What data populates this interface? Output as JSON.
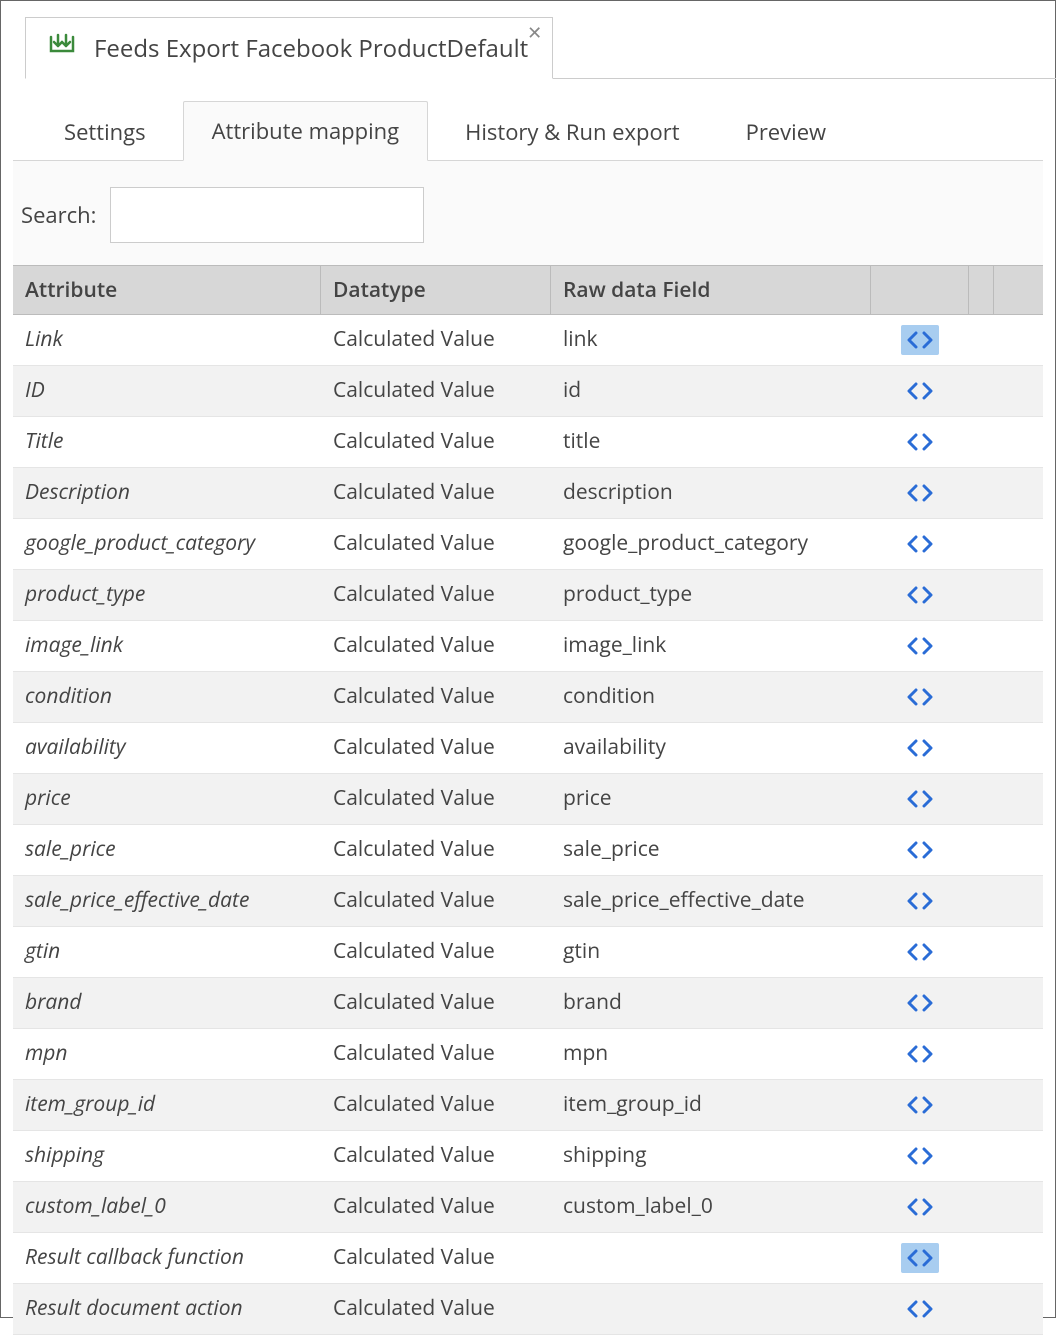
{
  "header": {
    "tab_title": "Feeds Export Facebook ProductDefault"
  },
  "tabs": [
    {
      "label": "Settings",
      "active": false
    },
    {
      "label": "Attribute mapping",
      "active": true
    },
    {
      "label": "History & Run export",
      "active": false
    },
    {
      "label": "Preview",
      "active": false
    }
  ],
  "search": {
    "label": "Search:",
    "value": ""
  },
  "grid": {
    "columns": {
      "attribute": "Attribute",
      "datatype": "Datatype",
      "rawfield": "Raw data Field"
    },
    "rows": [
      {
        "attribute": "Link",
        "datatype": "Calculated Value",
        "rawfield": "link",
        "selected": true
      },
      {
        "attribute": "ID",
        "datatype": "Calculated Value",
        "rawfield": "id",
        "selected": false
      },
      {
        "attribute": "Title",
        "datatype": "Calculated Value",
        "rawfield": "title",
        "selected": false
      },
      {
        "attribute": "Description",
        "datatype": "Calculated Value",
        "rawfield": "description",
        "selected": false
      },
      {
        "attribute": "google_product_category",
        "datatype": "Calculated Value",
        "rawfield": "google_product_category",
        "selected": false
      },
      {
        "attribute": "product_type",
        "datatype": "Calculated Value",
        "rawfield": "product_type",
        "selected": false
      },
      {
        "attribute": "image_link",
        "datatype": "Calculated Value",
        "rawfield": "image_link",
        "selected": false
      },
      {
        "attribute": "condition",
        "datatype": "Calculated Value",
        "rawfield": "condition",
        "selected": false
      },
      {
        "attribute": "availability",
        "datatype": "Calculated Value",
        "rawfield": "availability",
        "selected": false
      },
      {
        "attribute": "price",
        "datatype": "Calculated Value",
        "rawfield": "price",
        "selected": false
      },
      {
        "attribute": "sale_price",
        "datatype": "Calculated Value",
        "rawfield": "sale_price",
        "selected": false
      },
      {
        "attribute": "sale_price_effective_date",
        "datatype": "Calculated Value",
        "rawfield": "sale_price_effective_date",
        "selected": false
      },
      {
        "attribute": "gtin",
        "datatype": "Calculated Value",
        "rawfield": "gtin",
        "selected": false
      },
      {
        "attribute": "brand",
        "datatype": "Calculated Value",
        "rawfield": "brand",
        "selected": false
      },
      {
        "attribute": "mpn",
        "datatype": "Calculated Value",
        "rawfield": "mpn",
        "selected": false
      },
      {
        "attribute": "item_group_id",
        "datatype": "Calculated Value",
        "rawfield": "item_group_id",
        "selected": false
      },
      {
        "attribute": "shipping",
        "datatype": "Calculated Value",
        "rawfield": "shipping",
        "selected": false
      },
      {
        "attribute": "custom_label_0",
        "datatype": "Calculated Value",
        "rawfield": "custom_label_0",
        "selected": false
      },
      {
        "attribute": "Result callback function",
        "datatype": "Calculated Value",
        "rawfield": "",
        "selected": true
      },
      {
        "attribute": "Result document action",
        "datatype": "Calculated Value",
        "rawfield": "",
        "selected": false
      }
    ]
  }
}
